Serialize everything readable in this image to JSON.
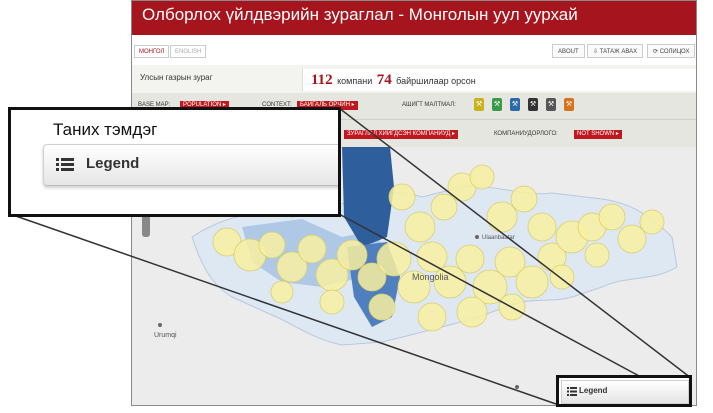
{
  "app": {
    "title": "Олборлох үйлдвэрийн зураглал - Монголын уул уурхай",
    "languages": [
      "МОНГОЛ",
      "ENGLISH"
    ],
    "top_buttons": {
      "about": "ABOUT",
      "download": "⇩ ТАТАЖ АВАХ",
      "share": "⟳ СОЛИЦОХ"
    }
  },
  "stats": {
    "country_map": "Улсын газрын зураг",
    "companies_count": "112",
    "companies_label": "компани",
    "locations_count": "74",
    "locations_label": "байршилаар орсон"
  },
  "filters": {
    "base_map_label": "BASE MAP:",
    "base_map_value": "POPULATION ▸",
    "context_label": "CONTEXT:",
    "context_value": "БАЙГАЛЬ ОРЧИН ▸",
    "minerals_label": "АШИГТ МАЛТМАЛ:",
    "companies_shown": "ЗУРАГЛАЛ ХИЙГДСЭН КОМПАНИУД ▸",
    "company_revenue_label": "КОМПАНИУДОРЛОГО:",
    "company_revenue_value": "NOT SHOWN ▸"
  },
  "minerals": [
    {
      "icon": "gold-icon",
      "color": "#c9b21a"
    },
    {
      "icon": "copper-icon",
      "color": "#3a9a4a"
    },
    {
      "icon": "coal-icon",
      "color": "#2b6aa8"
    },
    {
      "icon": "uranium-icon",
      "color": "#333333"
    },
    {
      "icon": "iron-icon",
      "color": "#555555"
    },
    {
      "icon": "other-icon",
      "color": "#d6731c"
    }
  ],
  "map": {
    "labels": {
      "urumqi": "Urumqi",
      "mongolia": "Mongolia",
      "ulaanbaatar": "Ulaanbaatar"
    },
    "colors": {
      "circle": "#f8f0a0",
      "circle_stroke": "#d9cf70",
      "region_dark": "#2e5f9c",
      "region_mid": "#6f9bcf",
      "region_light": "#aec8e6",
      "region_pale": "#dde8f3"
    }
  },
  "callout": {
    "title": "Таних тэмдэг",
    "legend_label": "Legend"
  },
  "legend_small": {
    "label": "Legend"
  }
}
